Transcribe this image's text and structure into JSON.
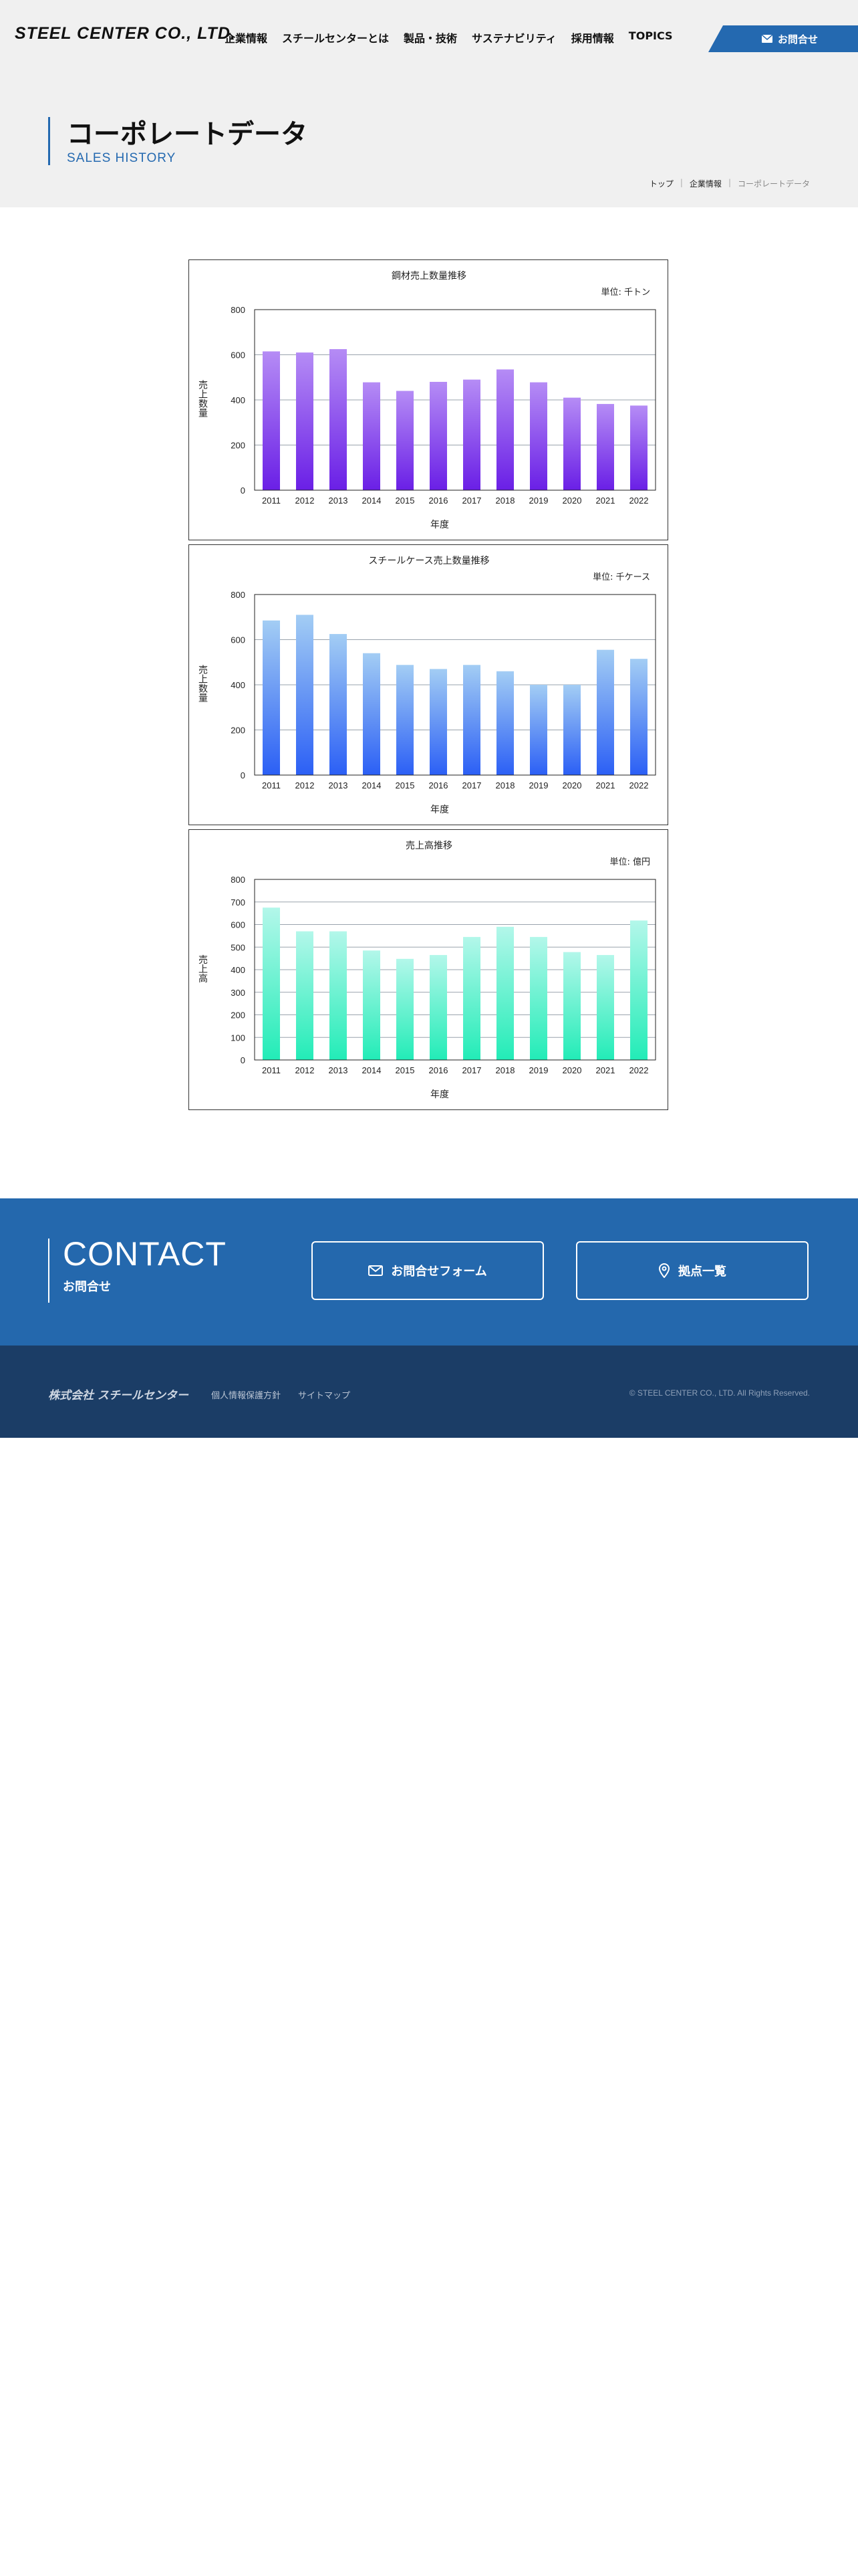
{
  "header": {
    "logo": "STEEL CENTER CO., LTD.",
    "nav": [
      "企業情報",
      "スチールセンターとは",
      "製品・技術",
      "サステナビリティ",
      "採用情報",
      "TOPICS"
    ],
    "contact_button": "お問合せ"
  },
  "page": {
    "title": "コーポレートデータ",
    "subtitle": "SALES HISTORY",
    "breadcrumb": [
      "トップ",
      "企業情報",
      "コーポレートデータ"
    ]
  },
  "chart_data": [
    {
      "type": "bar",
      "title": "鋼材売上数量推移",
      "unit": "単位: 千トン",
      "xlabel": "年度",
      "ylabel": "売上数量",
      "categories": [
        "2011",
        "2012",
        "2013",
        "2014",
        "2015",
        "2016",
        "2017",
        "2018",
        "2019",
        "2020",
        "2021",
        "2022"
      ],
      "values": [
        615,
        610,
        625,
        478,
        440,
        480,
        490,
        535,
        478,
        410,
        382,
        375
      ],
      "ylim": [
        0,
        800
      ],
      "yticks": [
        0,
        200,
        400,
        600,
        800
      ],
      "grid": true,
      "colors": {
        "top": "#b58cf5",
        "bottom": "#6a1fe6"
      }
    },
    {
      "type": "bar",
      "title": "スチールケース売上数量推移",
      "unit": "単位: 千ケース",
      "xlabel": "年度",
      "ylabel": "売上数量",
      "categories": [
        "2011",
        "2012",
        "2013",
        "2014",
        "2015",
        "2016",
        "2017",
        "2018",
        "2019",
        "2020",
        "2021",
        "2022"
      ],
      "values": [
        685,
        710,
        625,
        540,
        488,
        470,
        488,
        460,
        400,
        400,
        555,
        515
      ],
      "ylim": [
        0,
        800
      ],
      "yticks": [
        0,
        200,
        400,
        600,
        800
      ],
      "grid": true,
      "colors": {
        "top": "#a3cdf4",
        "bottom": "#2b5ff5"
      }
    },
    {
      "type": "bar",
      "title": "売上高推移",
      "unit": "単位: 億円",
      "xlabel": "年度",
      "ylabel": "売上高",
      "categories": [
        "2011",
        "2012",
        "2013",
        "2014",
        "2015",
        "2016",
        "2017",
        "2018",
        "2019",
        "2020",
        "2021",
        "2022"
      ],
      "values": [
        675,
        570,
        570,
        485,
        448,
        465,
        545,
        590,
        545,
        478,
        465,
        618
      ],
      "ylim": [
        0,
        800
      ],
      "yticks": [
        0,
        100,
        200,
        300,
        400,
        500,
        600,
        700,
        800
      ],
      "grid": true,
      "colors": {
        "top": "#b3f7ea",
        "bottom": "#22ecb7"
      }
    }
  ],
  "contact": {
    "title_en": "CONTACT",
    "title_ja": "お問合せ",
    "form_button": "お問合せフォーム",
    "locations_button": "拠点一覧"
  },
  "footer": {
    "logo": "株式会社 スチールセンター",
    "links": [
      "個人情報保護方針",
      "サイトマップ"
    ],
    "copyright": "© STEEL CENTER CO., LTD. All Rights Reserved."
  }
}
